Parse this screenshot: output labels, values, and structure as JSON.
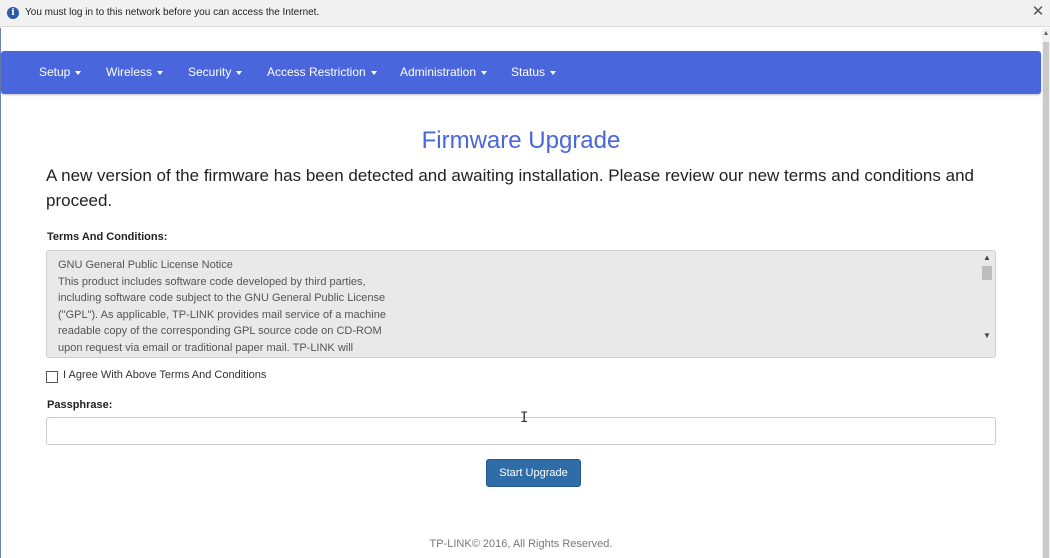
{
  "notification": {
    "icon": "info-icon",
    "text": "You must log in to this network before you can access the Internet.",
    "close_icon": "close-icon"
  },
  "nav": {
    "items": [
      {
        "label": "Setup"
      },
      {
        "label": "Wireless"
      },
      {
        "label": "Security"
      },
      {
        "label": "Access Restriction"
      },
      {
        "label": "Administration"
      },
      {
        "label": "Status"
      }
    ],
    "color": "#4a66dc"
  },
  "page": {
    "title": "Firmware Upgrade",
    "intro": "A new version of the firmware has been detected and awaiting installation. Please review our new terms and conditions and proceed."
  },
  "terms": {
    "label": "Terms And Conditions:",
    "lines": [
      "GNU General Public License Notice",
      "This product includes software code developed by third parties,",
      "including software code subject to the GNU General Public License",
      "(\"GPL\"). As applicable, TP-LINK provides mail service of a machine",
      "readable copy of the corresponding GPL source code on CD-ROM",
      "upon request via email or traditional paper mail. TP-LINK will"
    ]
  },
  "agree": {
    "label": "I Agree With Above Terms And Conditions",
    "checked": false
  },
  "passphrase": {
    "label": "Passphrase:",
    "value": "",
    "placeholder": ""
  },
  "actions": {
    "start_label": "Start Upgrade",
    "button_color": "#2f6da8"
  },
  "footer": {
    "text": "TP-LINK© 2016, All Rights Reserved."
  }
}
